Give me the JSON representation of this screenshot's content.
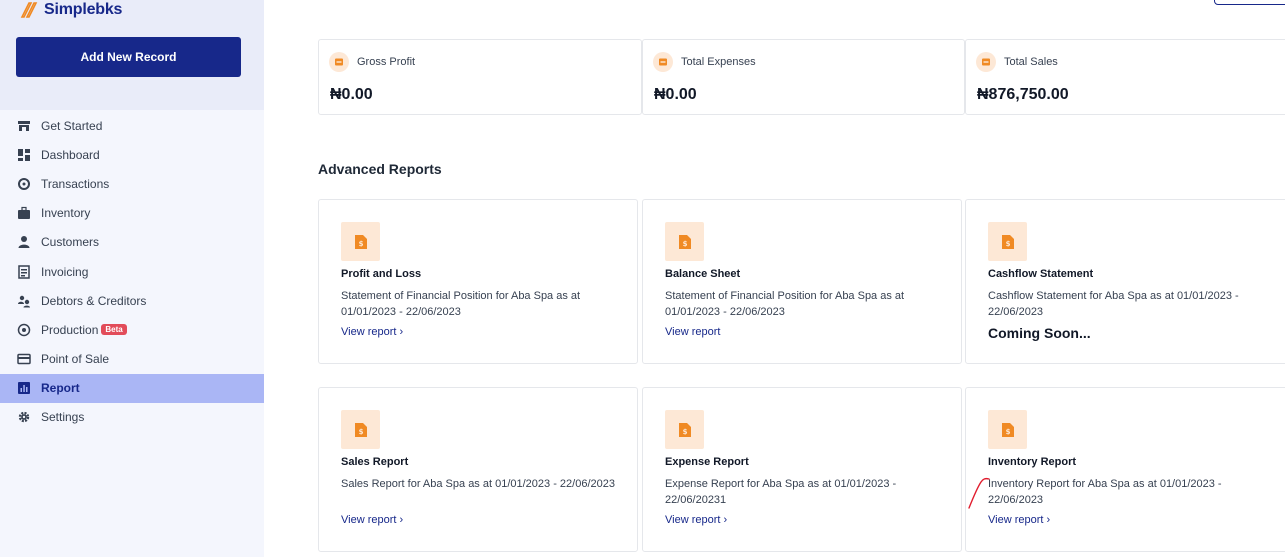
{
  "brand": {
    "name": "Simplebks"
  },
  "sidebar": {
    "add_button": "Add New Record",
    "items": [
      {
        "label": "Get Started",
        "icon": "store-icon"
      },
      {
        "label": "Dashboard",
        "icon": "dashboard-icon"
      },
      {
        "label": "Transactions",
        "icon": "refresh-icon"
      },
      {
        "label": "Inventory",
        "icon": "briefcase-icon"
      },
      {
        "label": "Customers",
        "icon": "user-icon"
      },
      {
        "label": "Invoicing",
        "icon": "invoice-icon"
      },
      {
        "label": "Debtors & Creditors",
        "icon": "people-icon"
      },
      {
        "label": "Production",
        "icon": "production-icon",
        "badge": "Beta"
      },
      {
        "label": "Point of Sale",
        "icon": "card-icon"
      },
      {
        "label": "Report",
        "icon": "report-icon",
        "active": true
      },
      {
        "label": "Settings",
        "icon": "gear-icon"
      }
    ]
  },
  "summary": [
    {
      "label": "Gross Profit",
      "value": "₦0.00"
    },
    {
      "label": "Total Expenses",
      "value": "₦0.00"
    },
    {
      "label": "Total Sales",
      "value": "₦876,750.00"
    }
  ],
  "advanced_reports": {
    "title": "Advanced Reports",
    "cards": [
      {
        "title": "Profit and Loss",
        "desc": "Statement of Financial Position for Aba Spa as at 01/01/2023 - 22/06/2023",
        "link": "View report ›"
      },
      {
        "title": "Balance Sheet",
        "desc": "Statement of Financial Position for Aba Spa as at 01/01/2023 - 22/06/2023",
        "link": "View report"
      },
      {
        "title": "Cashflow Statement",
        "desc": "Cashflow Statement for Aba Spa as at 01/01/2023 - 22/06/2023",
        "status": "Coming Soon..."
      },
      {
        "title": "Sales Report",
        "desc": "Sales Report for Aba Spa as at 01/01/2023 - 22/06/2023",
        "link": "View report ›"
      },
      {
        "title": "Expense Report",
        "desc": "Expense Report for Aba Spa as at 01/01/2023 - 22/06/20231",
        "link": "View report ›"
      },
      {
        "title": "Inventory Report",
        "desc": "Inventory Report for Aba Spa as at 01/01/2023 - 22/06/2023",
        "link": "View report ›"
      }
    ]
  },
  "colors": {
    "primary": "#17288a",
    "accent_bg": "#fde8d6",
    "accent_icon": "#f08a24",
    "active_nav": "#aab6f5",
    "beta_badge": "#e24c5a"
  }
}
